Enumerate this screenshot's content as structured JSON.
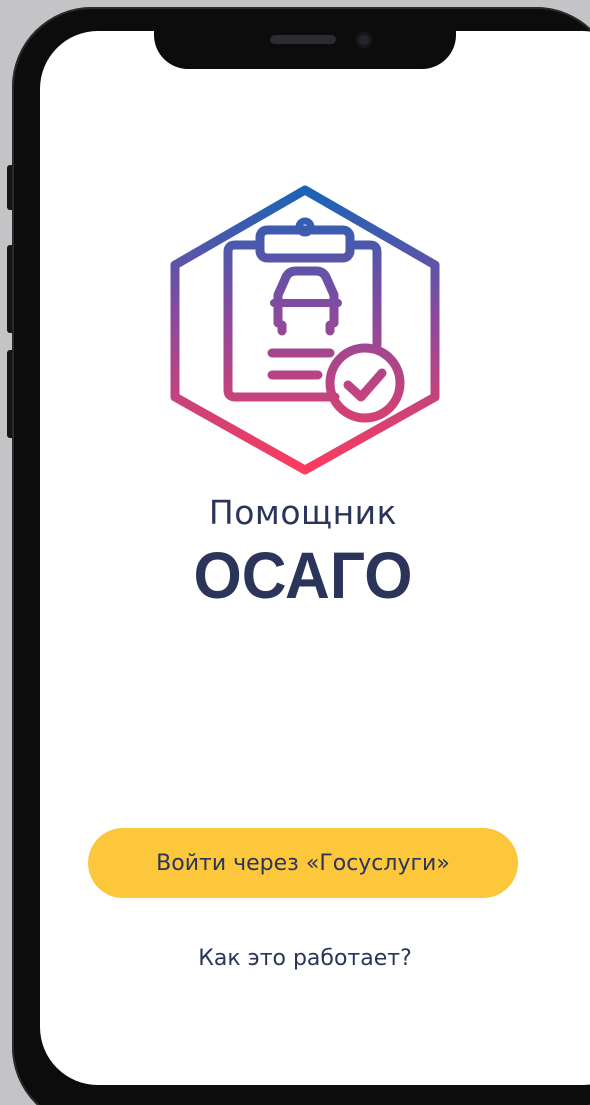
{
  "app": {
    "subtitle": "Помощник",
    "title": "ОСАГО",
    "logo_icon": "clipboard-car-check-icon"
  },
  "actions": {
    "login_label": "Войти через «Госуслуги»",
    "how_it_works_label": "Как это работает?"
  },
  "colors": {
    "gradient_top": "#1565b8",
    "gradient_bottom": "#ff3b5c",
    "button": "#fcc73b",
    "text": "#2b3559",
    "background": "#ffffff"
  }
}
